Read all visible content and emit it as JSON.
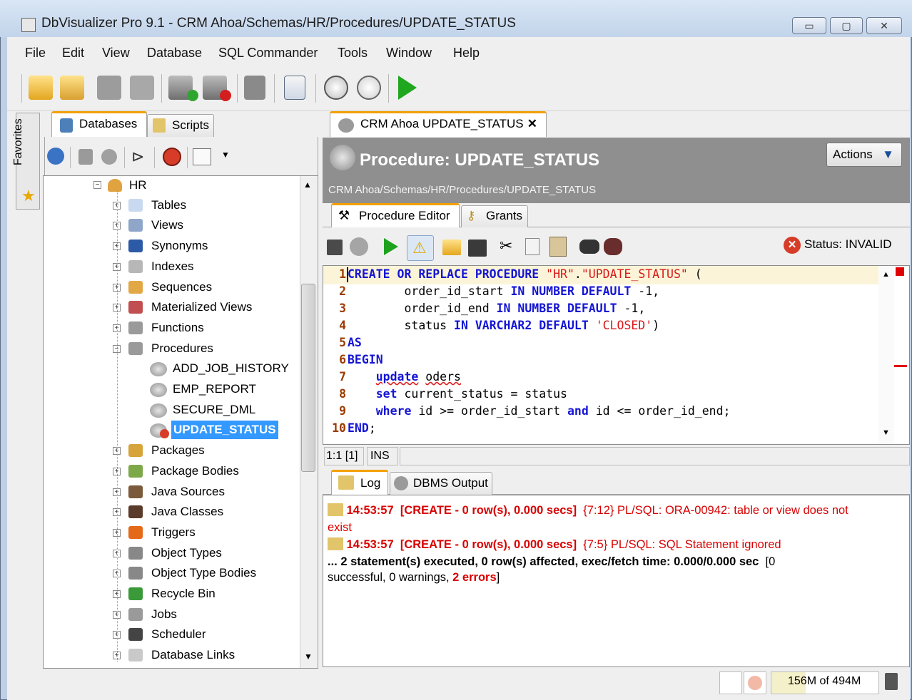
{
  "window": {
    "title": "DbVisualizer Pro 9.1 - CRM Ahoa/Schemas/HR/Procedures/UPDATE_STATUS",
    "minimize": "▭",
    "maximize": "▢",
    "close": "✕"
  },
  "menu": [
    "File",
    "Edit",
    "View",
    "Database",
    "SQL Commander",
    "Tools",
    "Window",
    "Help"
  ],
  "favorites_label": "Favorites",
  "left_tabs": {
    "databases": "Databases",
    "scripts": "Scripts"
  },
  "tree": {
    "root": "HR",
    "items": [
      "Tables",
      "Views",
      "Synonyms",
      "Indexes",
      "Sequences",
      "Materialized Views",
      "Functions",
      "Procedures"
    ],
    "procedures": [
      "ADD_JOB_HISTORY",
      "EMP_REPORT",
      "SECURE_DML",
      "UPDATE_STATUS"
    ],
    "more": [
      "Packages",
      "Package Bodies",
      "Java Sources",
      "Java Classes",
      "Triggers",
      "Object Types",
      "Object Type Bodies",
      "Recycle Bin",
      "Jobs",
      "Scheduler",
      "Database Links"
    ]
  },
  "editor_tab": {
    "label": "CRM Ahoa UPDATE_STATUS",
    "close": "✕"
  },
  "header": {
    "title": "Procedure: UPDATE_STATUS",
    "path": "CRM Ahoa/Schemas/HR/Procedures/UPDATE_STATUS",
    "actions": "Actions"
  },
  "subtabs": {
    "editor": "Procedure Editor",
    "grants": "Grants"
  },
  "status": "Status: INVALID",
  "code": {
    "line_numbers": [
      "1",
      "2",
      "3",
      "4",
      "5",
      "6",
      "7",
      "8",
      "9",
      "10"
    ]
  },
  "cursor_info": {
    "position": "1:1 [1]",
    "mode": "INS"
  },
  "log_tabs": {
    "log": "Log",
    "dbms": "DBMS Output"
  },
  "log": {
    "l1_time": "14:53:57",
    "l1_result": "[CREATE - 0 row(s), 0.000 secs]",
    "l1_msg": "{7:12} PL/SQL: ORA-00942: table or view does not",
    "l1_cont": "exist",
    "l2_time": "14:53:57",
    "l2_result": "[CREATE - 0 row(s), 0.000 secs]",
    "l2_msg": "{7:5} PL/SQL: SQL Statement ignored",
    "summary": "... 2 statement(s) executed, 0 row(s) affected, exec/fetch time: 0.000/0.000 sec",
    "summary_tail": "[0",
    "summary2_a": "successful, 0 warnings,",
    "summary2_b": "2 errors",
    "summary2_c": "]"
  },
  "memory": "156M of 494M"
}
